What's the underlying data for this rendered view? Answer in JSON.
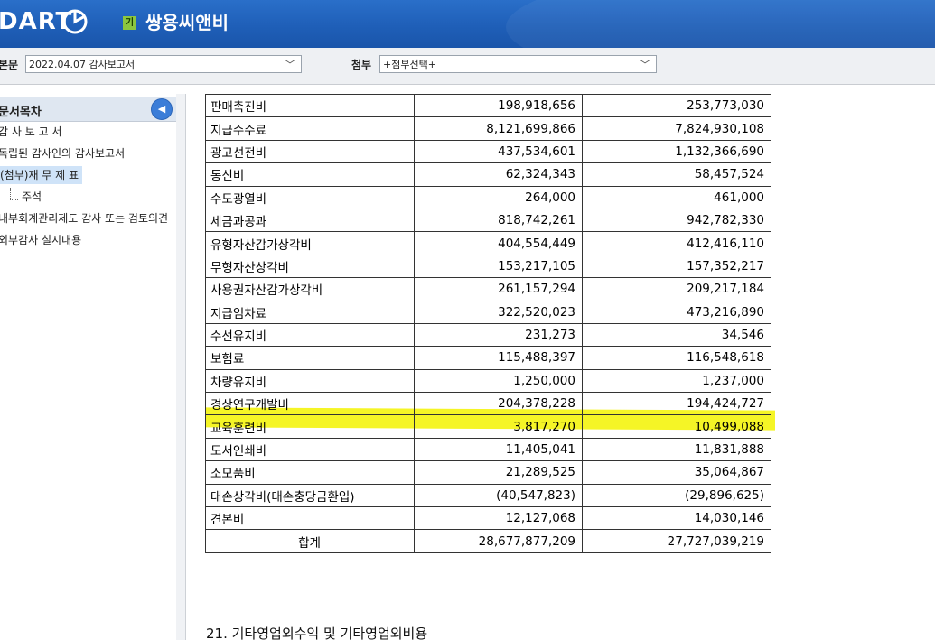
{
  "header": {
    "logo_text": "DART",
    "company_badge": "기",
    "company_name": "쌍용씨앤비"
  },
  "selectors": {
    "main_label": "본문",
    "main_value": "2022.04.07  감사보고서",
    "attach_label": "첨부",
    "attach_value": "+첨부선택+"
  },
  "toc": {
    "title": "문서목차",
    "items": [
      {
        "label": "감 사 보 고 서"
      },
      {
        "label": "독립된 감사인의 감사보고서"
      },
      {
        "label": "(첨부)재 무 제 표"
      },
      {
        "label": "주석"
      },
      {
        "label": "내부회계관리제도 감사 또는 검토의견"
      },
      {
        "label": "외부감사 실시내용"
      }
    ]
  },
  "table": {
    "rows": [
      {
        "name": "판매촉진비",
        "current": "198,918,656",
        "prior": "253,773,030"
      },
      {
        "name": "지급수수료",
        "current": "8,121,699,866",
        "prior": "7,824,930,108"
      },
      {
        "name": "광고선전비",
        "current": "437,534,601",
        "prior": "1,132,366,690"
      },
      {
        "name": "통신비",
        "current": "62,324,343",
        "prior": "58,457,524"
      },
      {
        "name": "수도광열비",
        "current": "264,000",
        "prior": "461,000"
      },
      {
        "name": "세금과공과",
        "current": "818,742,261",
        "prior": "942,782,330"
      },
      {
        "name": "유형자산감가상각비",
        "current": "404,554,449",
        "prior": "412,416,110"
      },
      {
        "name": "무형자산상각비",
        "current": "153,217,105",
        "prior": "157,352,217"
      },
      {
        "name": "사용권자산감가상각비",
        "current": "261,157,294",
        "prior": "209,217,184"
      },
      {
        "name": "지급임차료",
        "current": "322,520,023",
        "prior": "473,216,890"
      },
      {
        "name": "수선유지비",
        "current": "231,273",
        "prior": "34,546"
      },
      {
        "name": "보험료",
        "current": "115,488,397",
        "prior": "116,548,618"
      },
      {
        "name": "차량유지비",
        "current": "1,250,000",
        "prior": "1,237,000"
      },
      {
        "name": "경상연구개발비",
        "current": "204,378,228",
        "prior": "194,424,727"
      },
      {
        "name": "교육훈련비",
        "current": "3,817,270",
        "prior": "10,499,088"
      },
      {
        "name": "도서인쇄비",
        "current": "11,405,041",
        "prior": "11,831,888"
      },
      {
        "name": "소모품비",
        "current": "21,289,525",
        "prior": "35,064,867"
      },
      {
        "name": "대손상각비(대손충당금환입)",
        "current": "(40,547,823)",
        "prior": "(29,896,625)"
      },
      {
        "name": "견본비",
        "current": "12,127,068",
        "prior": "14,030,146"
      }
    ],
    "total": {
      "name": "합계",
      "current": "28,677,877,209",
      "prior": "27,727,039,219"
    },
    "highlight_color": "#f3f300"
  },
  "section_note": "21. 기타영업외수익 및 기타영업외비용"
}
